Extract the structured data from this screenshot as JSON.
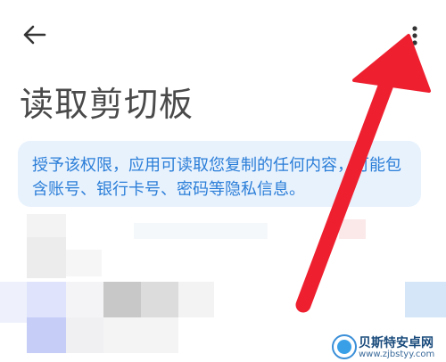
{
  "header": {
    "back_icon": "arrow-left-icon",
    "more_icon": "more-vertical-icon"
  },
  "page": {
    "title": "读取剪切板"
  },
  "notice": {
    "text": "授予该权限，应用可读取您复制的任何内容，可能包含账号、银行卡号、密码等隐私信息。"
  },
  "watermark": {
    "name": "贝斯特安卓网",
    "url": "www.zjbstyy.com"
  },
  "colors": {
    "title": "#4a4a4a",
    "notice_text": "#2b7ed8",
    "notice_bg": "#e8f2fd",
    "annotation": "#ee2030"
  }
}
